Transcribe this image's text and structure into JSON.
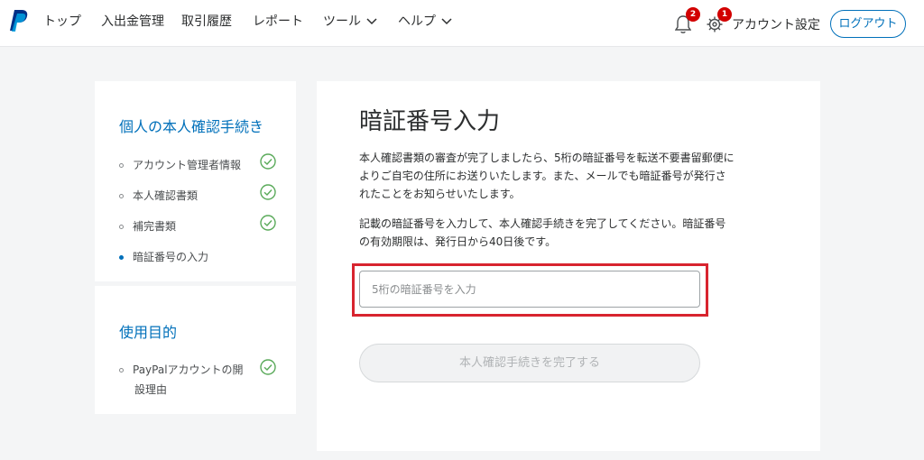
{
  "header": {
    "logo": "paypal-logo",
    "nav": [
      {
        "label": "トップ"
      },
      {
        "label": "入出金管理"
      },
      {
        "label": "取引履歴"
      },
      {
        "label": "レポート"
      },
      {
        "label": "ツール"
      },
      {
        "label": "ヘルプ"
      }
    ],
    "notifications_count": "2",
    "settings_count": "1",
    "account_label": "アカウント設定",
    "logout_label": "ログアウト"
  },
  "sidebar": {
    "section1": {
      "title": "個人の本人確認手続き",
      "steps": [
        {
          "label": "アカウント管理者情報",
          "completed": true
        },
        {
          "label": "本人確認書類",
          "completed": true
        },
        {
          "label": "補完書類",
          "completed": true
        },
        {
          "label": "暗証番号の入力",
          "completed": false
        }
      ]
    },
    "section2": {
      "title": "使用目的",
      "steps": [
        {
          "label_line1": "PayPalアカウントの開",
          "label_line2": "設理由",
          "completed": true
        }
      ]
    }
  },
  "main": {
    "title": "暗証番号入力",
    "para1": [
      "本人確認書類の審査が完了しましたら、5桁の暗証番号を転送不要書留郵便に",
      "よりご自宅の住所にお送りいたします。また、メールでも暗証番号が発行さ",
      "れたことをお知らせいたします。"
    ],
    "para2": [
      "記載の暗証番号を入力して、本人確認手続きを完了してください。暗証番号",
      "の有効期限は、発行日から40日後です。"
    ],
    "pin_input": {
      "value": "",
      "placeholder": "5桁の暗証番号を入力"
    },
    "submit_label": "本人確認手続きを完了する"
  },
  "colors": {
    "accent": "#0070ba",
    "highlight": "#d8242f",
    "badge": "#d20000",
    "check": "#5aaa5a"
  }
}
